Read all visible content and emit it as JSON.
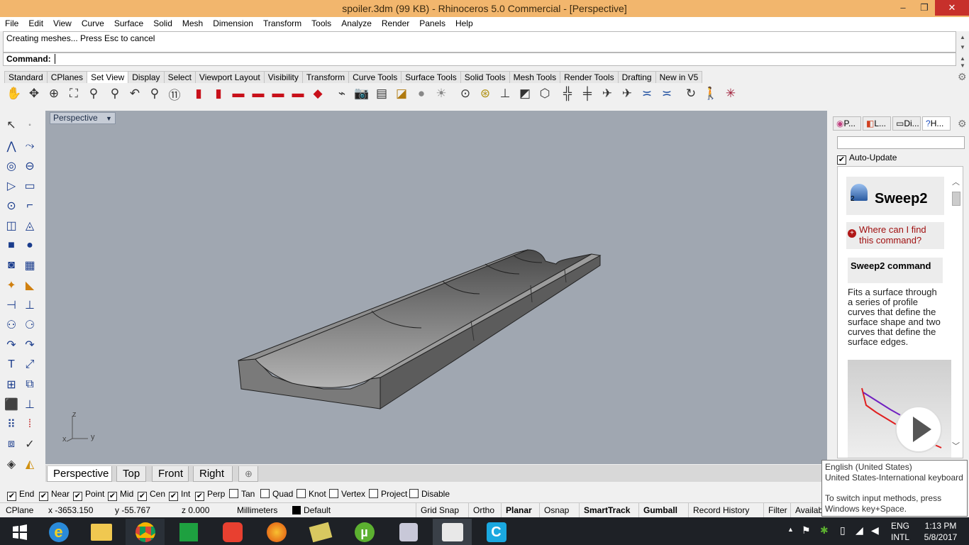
{
  "window": {
    "title": "spoiler.3dm (99 KB) - Rhinoceros 5.0 Commercial - [Perspective]",
    "minimize_glyph": "–",
    "restore_glyph": "❐",
    "close_glyph": "✕"
  },
  "menu": [
    "File",
    "Edit",
    "View",
    "Curve",
    "Surface",
    "Solid",
    "Mesh",
    "Dimension",
    "Transform",
    "Tools",
    "Analyze",
    "Render",
    "Panels",
    "Help"
  ],
  "command": {
    "history": "Creating meshes... Press Esc to cancel",
    "label": "Command:",
    "value": ""
  },
  "toolbar_tabs": [
    "Standard",
    "CPlanes",
    "Set View",
    "Display",
    "Select",
    "Viewport Layout",
    "Visibility",
    "Transform",
    "Curve Tools",
    "Surface Tools",
    "Solid Tools",
    "Mesh Tools",
    "Render Tools",
    "Drafting",
    "New in V5"
  ],
  "active_toolbar_tab": "Set View",
  "viewport": {
    "label": "Perspective",
    "axis_z": "z",
    "axis_x": "x",
    "axis_y": "y"
  },
  "view_tabs": [
    "Perspective",
    "Top",
    "Front",
    "Right"
  ],
  "active_view_tab": "Perspective",
  "add_view_glyph": "⊕",
  "osnaps": [
    {
      "label": "End",
      "checked": true
    },
    {
      "label": "Near",
      "checked": true
    },
    {
      "label": "Point",
      "checked": true
    },
    {
      "label": "Mid",
      "checked": true
    },
    {
      "label": "Cen",
      "checked": true
    },
    {
      "label": "Int",
      "checked": true
    },
    {
      "label": "Perp",
      "checked": true
    },
    {
      "label": "Tan",
      "checked": false
    },
    {
      "label": "Quad",
      "checked": false
    },
    {
      "label": "Knot",
      "checked": false
    },
    {
      "label": "Vertex",
      "checked": false
    },
    {
      "label": "Project",
      "checked": false
    },
    {
      "label": "Disable",
      "checked": false
    }
  ],
  "status": {
    "cplane": "CPlane",
    "x": "x -3653.150",
    "y": "y -55.767",
    "z": "z 0.000",
    "units": "Millimeters",
    "layer": "Default",
    "grid_snap": "Grid Snap",
    "ortho": "Ortho",
    "planar": "Planar",
    "osnap": "Osnap",
    "smarttrack": "SmartTrack",
    "gumball": "Gumball",
    "record_history": "Record History",
    "filter": "Filter",
    "available": "Availab"
  },
  "right_panel": {
    "tabs": [
      "P...",
      "L...",
      "Di...",
      "H..."
    ],
    "auto_update": "Auto-Update",
    "help_title": "Sweep2",
    "help_badge": "2",
    "find_link": "Where can I find this command?",
    "cmd_heading": "Sweep2 command",
    "description": "Fits a surface through a series of profile curves that define the surface shape and two curves that define the surface edges."
  },
  "tooltip": {
    "line1": "English (United States)",
    "line2": "United States-International keyboard",
    "line3": "To switch input methods, press Windows key+Space."
  },
  "taskbar": {
    "lang1": "ENG",
    "lang2": "INTL",
    "time": "1:13 PM",
    "date": "5/8/2017"
  }
}
